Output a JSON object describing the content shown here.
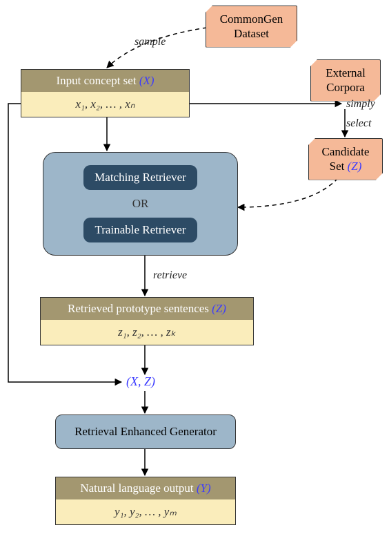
{
  "commongen": {
    "line1": "CommonGen",
    "line2": "Dataset"
  },
  "external": {
    "line1": "External",
    "line2": "Corpora"
  },
  "candidate": {
    "line1": "Candidate",
    "line2_prefix": "Set ",
    "var": "(Z)"
  },
  "input_concept": {
    "header_prefix": "Input concept set ",
    "header_var": "(X)",
    "body": "x₁, x₂, … , xₙ"
  },
  "retriever": {
    "matching": "Matching Retriever",
    "or": "OR",
    "trainable": "Trainable Retriever"
  },
  "retrieved": {
    "header_prefix": "Retrieved prototype sentences ",
    "header_var": "(Z)",
    "body": "z₁, z₂, … , zₖ"
  },
  "xz_label": "(X, Z)",
  "generator": "Retrieval Enhanced Generator",
  "output": {
    "header_prefix": "Natural language output ",
    "header_var": "(Y)",
    "body": "y₁, y₂, … , yₘ"
  },
  "edges": {
    "sample": "sample",
    "simply": "simply",
    "select": "select",
    "retrieve": "retrieve"
  },
  "chart_data": {
    "type": "flow-diagram",
    "nodes": [
      {
        "id": "commongen",
        "label": "CommonGen Dataset",
        "kind": "data-source"
      },
      {
        "id": "external",
        "label": "External Corpora",
        "kind": "data-source"
      },
      {
        "id": "input_concept",
        "label": "Input concept set (X)",
        "content": "x1, x2, …, xn",
        "kind": "variable-set"
      },
      {
        "id": "candidate",
        "label": "Candidate Set (Z)",
        "kind": "data-source"
      },
      {
        "id": "retriever",
        "label": "Matching Retriever OR Trainable Retriever",
        "kind": "module"
      },
      {
        "id": "retrieved",
        "label": "Retrieved prototype sentences (Z)",
        "content": "z1, z2, …, zk",
        "kind": "variable-set"
      },
      {
        "id": "xz",
        "label": "(X, Z)",
        "kind": "tuple"
      },
      {
        "id": "generator",
        "label": "Retrieval Enhanced Generator",
        "kind": "module"
      },
      {
        "id": "output",
        "label": "Natural language output (Y)",
        "content": "y1, y2, …, ym",
        "kind": "variable-set"
      }
    ],
    "edges": [
      {
        "from": "commongen",
        "to": "input_concept",
        "label": "sample",
        "style": "dashed"
      },
      {
        "from": "input_concept",
        "to": "external",
        "label": "simply",
        "style": "solid"
      },
      {
        "from": "external",
        "to": "candidate",
        "label": "select",
        "style": "solid"
      },
      {
        "from": "candidate",
        "to": "retriever",
        "style": "dashed"
      },
      {
        "from": "input_concept",
        "to": "retriever",
        "style": "solid"
      },
      {
        "from": "retriever",
        "to": "retrieved",
        "label": "retrieve",
        "style": "solid"
      },
      {
        "from": "retrieved",
        "to": "xz",
        "style": "solid"
      },
      {
        "from": "input_concept",
        "to": "xz",
        "style": "solid"
      },
      {
        "from": "xz",
        "to": "generator",
        "style": "solid"
      },
      {
        "from": "generator",
        "to": "output",
        "style": "solid"
      }
    ]
  }
}
